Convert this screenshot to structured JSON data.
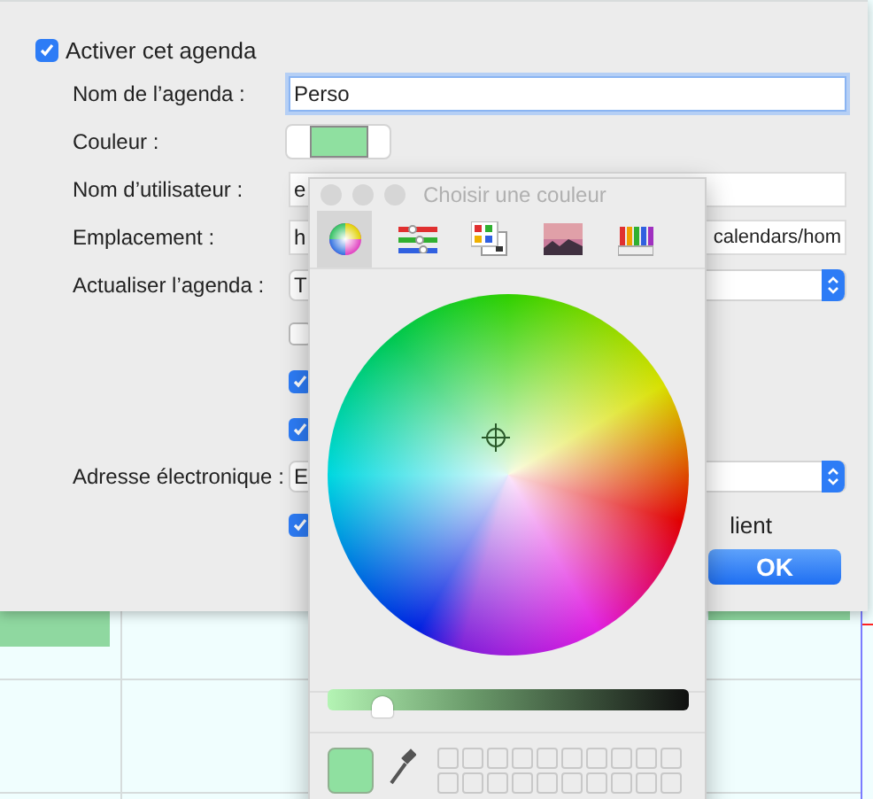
{
  "calendar_settings": {
    "enable": {
      "label": "Activer cet agenda",
      "checked": true
    },
    "fields": [
      {
        "kind": "text",
        "label": "Nom de l’agenda :",
        "value": "Perso",
        "focused": true
      },
      {
        "kind": "color",
        "label": "Couleur :",
        "color": "#8fe0a0"
      },
      {
        "kind": "text",
        "label": "Nom d’utilisateur :",
        "value": "e",
        "focused": false
      },
      {
        "kind": "text",
        "label": "Emplacement :",
        "value": "h",
        "value_end": "calendars/hom",
        "focused": false
      },
      {
        "kind": "select",
        "label": "Actualiser l’agenda :",
        "value": "T"
      },
      {
        "kind": "checkbox",
        "checked": false
      },
      {
        "kind": "checkbox",
        "checked": true
      },
      {
        "kind": "checkbox",
        "checked": true
      },
      {
        "kind": "select",
        "label": "Adresse électronique :",
        "value": "E"
      },
      {
        "kind": "checkbox",
        "checked": true,
        "label_end": "lient"
      }
    ],
    "buttons": [
      {
        "label": "OK"
      }
    ]
  },
  "color_picker": {
    "title": "Choisir une couleur",
    "modes": [
      {
        "kind": "wheel",
        "selected": true
      },
      {
        "kind": "sliders",
        "selected": false
      },
      {
        "kind": "palettes",
        "selected": false
      },
      {
        "kind": "image",
        "selected": false
      },
      {
        "kind": "pencils",
        "selected": false
      }
    ],
    "brightness": {
      "level": 0.15
    }
  }
}
